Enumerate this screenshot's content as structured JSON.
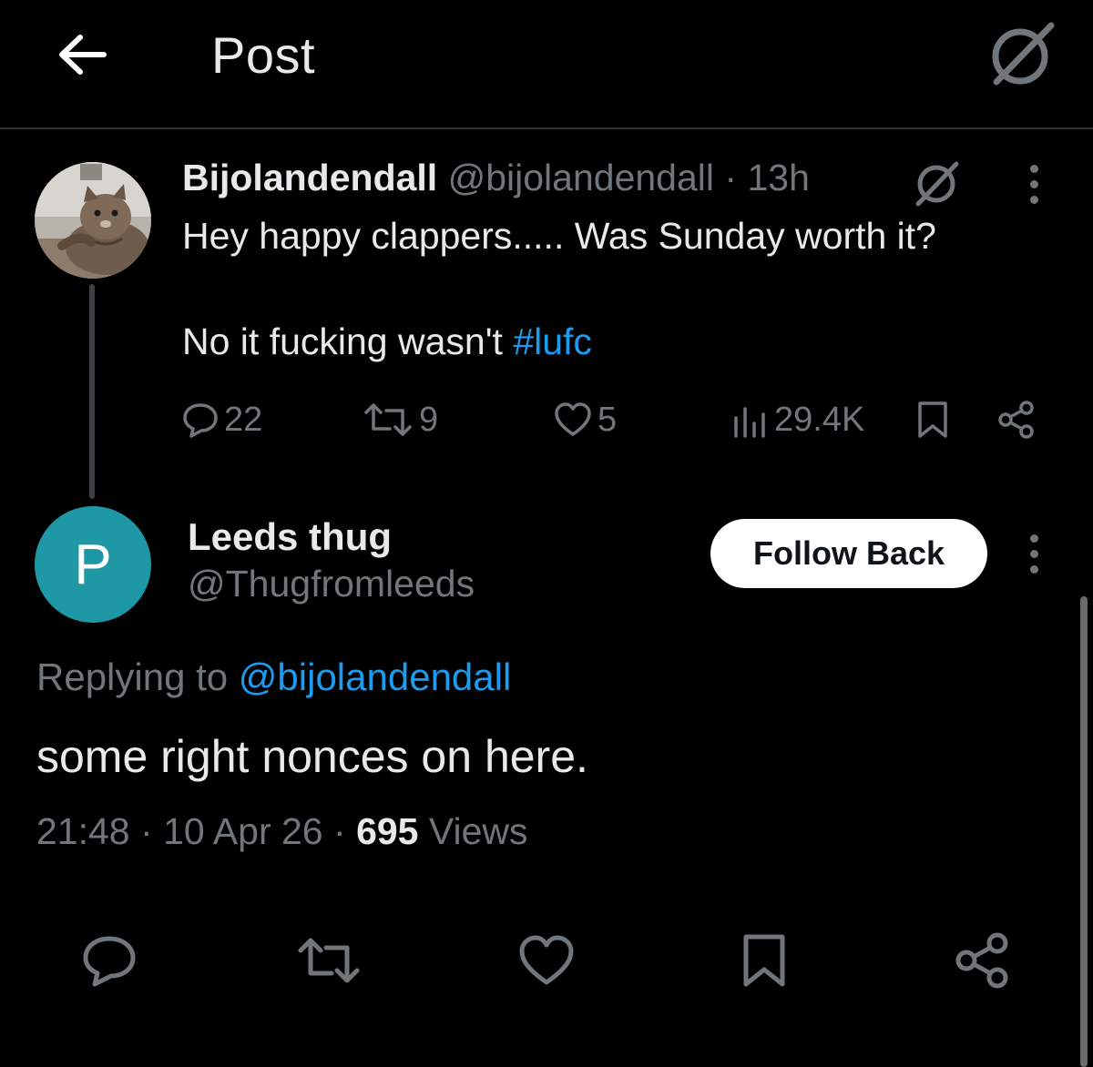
{
  "header": {
    "title": "Post",
    "back_icon": "arrow-left-icon",
    "grok_icon": "grok-icon"
  },
  "parent_post": {
    "display_name": "Bijolandendall",
    "handle": "@bijolandendall",
    "separator": "·",
    "time": "13h",
    "text_line1": "Hey happy clappers..... Was Sunday worth it?",
    "text_line2": "No it fucking wasn't ",
    "hashtag": "#lufc",
    "replies": "22",
    "reposts": "9",
    "likes": "5",
    "views": "29.4K"
  },
  "reply_post": {
    "avatar_letter": "P",
    "display_name": "Leeds thug",
    "handle": "@Thugfromleeds",
    "follow_label": "Follow Back",
    "replying_prefix": "Replying to ",
    "replying_to": "@bijolandendall",
    "text": "some right nonces on here.",
    "time": "21:48",
    "date": "10 Apr 26",
    "views_count": "695",
    "views_label": " Views"
  },
  "colors": {
    "background": "#000000",
    "text": "#e7e9ea",
    "muted": "#71767b",
    "link": "#1d9bf0",
    "avatar_p": "#1f98a6"
  }
}
